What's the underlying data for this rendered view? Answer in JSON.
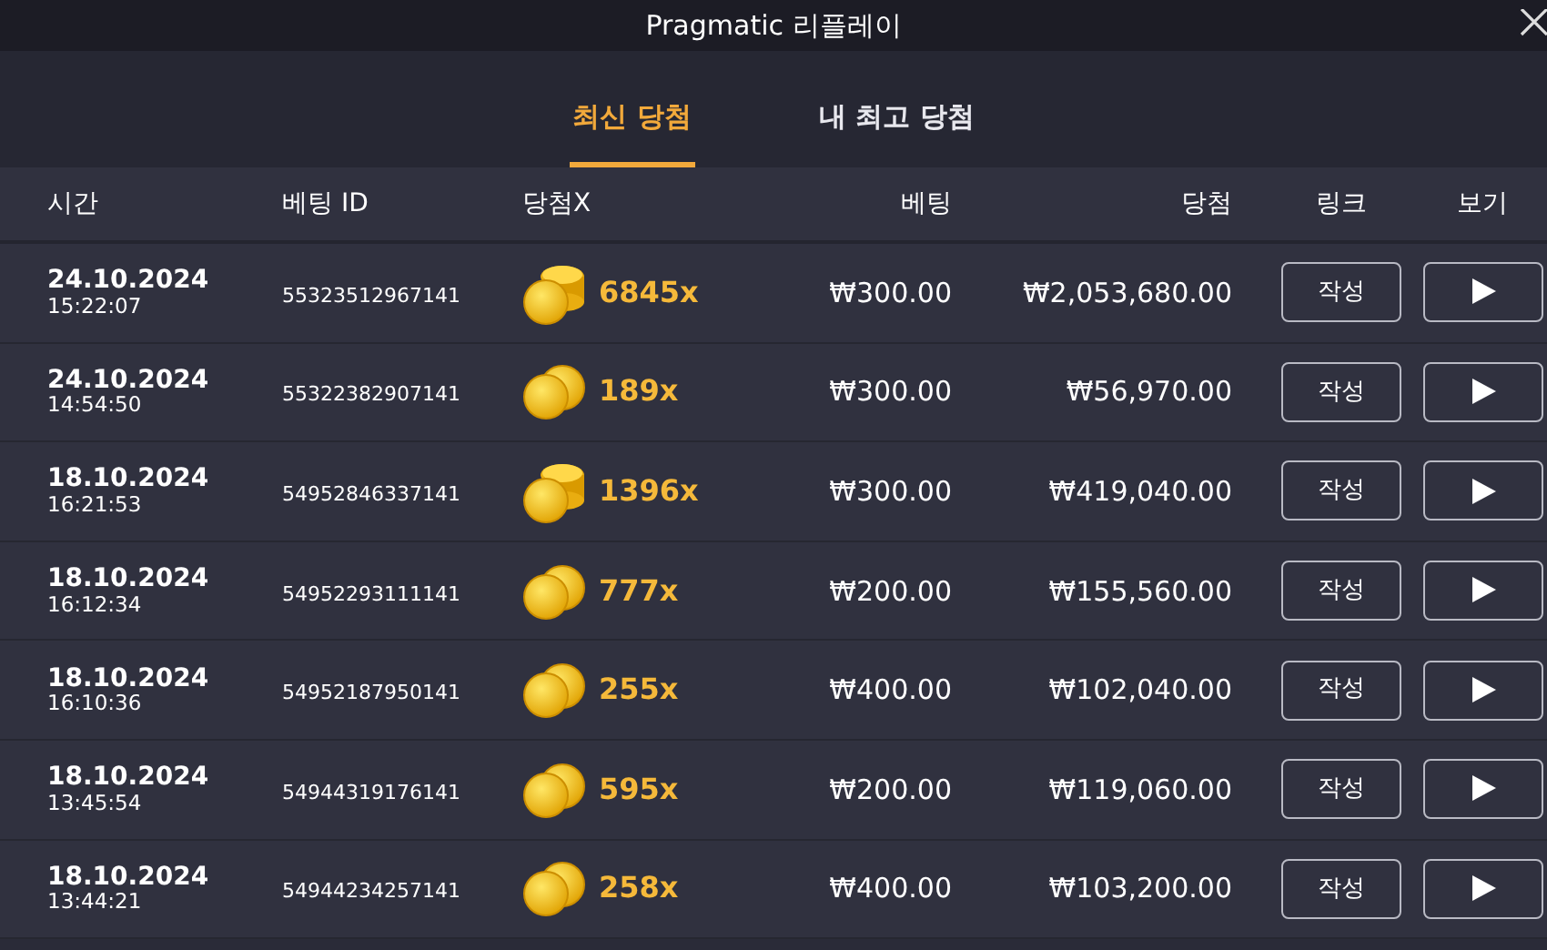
{
  "window": {
    "title": "Pragmatic 리플레이"
  },
  "tabs": [
    {
      "label": "최신 당첨",
      "selected": true
    },
    {
      "label": "내 최고 당첨",
      "selected": false
    }
  ],
  "table": {
    "columns": [
      "시간",
      "베팅 ID",
      "당첨X",
      "베팅",
      "당첨",
      "링크",
      "보기"
    ],
    "rows": [
      {
        "date": "24.10.2024",
        "time": "15:22:07",
        "bet_id": "55323512967141",
        "kind": "pile",
        "multiplier": "6845x",
        "bet": "₩300.00",
        "win": "₩2,053,680.00",
        "link": "작성"
      },
      {
        "date": "24.10.2024",
        "time": "14:54:50",
        "bet_id": "55322382907141",
        "kind": "pair",
        "multiplier": "189x",
        "bet": "₩300.00",
        "win": "₩56,970.00",
        "link": "작성"
      },
      {
        "date": "18.10.2024",
        "time": "16:21:53",
        "bet_id": "54952846337141",
        "kind": "pile",
        "multiplier": "1396x",
        "bet": "₩300.00",
        "win": "₩419,040.00",
        "link": "작성"
      },
      {
        "date": "18.10.2024",
        "time": "16:12:34",
        "bet_id": "54952293111141",
        "kind": "pair",
        "multiplier": "777x",
        "bet": "₩200.00",
        "win": "₩155,560.00",
        "link": "작성"
      },
      {
        "date": "18.10.2024",
        "time": "16:10:36",
        "bet_id": "54952187950141",
        "kind": "pair",
        "multiplier": "255x",
        "bet": "₩400.00",
        "win": "₩102,040.00",
        "link": "작성"
      },
      {
        "date": "18.10.2024",
        "time": "13:45:54",
        "bet_id": "54944319176141",
        "kind": "pair",
        "multiplier": "595x",
        "bet": "₩200.00",
        "win": "₩119,060.00",
        "link": "작성"
      },
      {
        "date": "18.10.2024",
        "time": "13:44:21",
        "bet_id": "54944234257141",
        "kind": "pair",
        "multiplier": "258x",
        "bet": "₩400.00",
        "win": "₩103,200.00",
        "link": "작성"
      }
    ]
  }
}
